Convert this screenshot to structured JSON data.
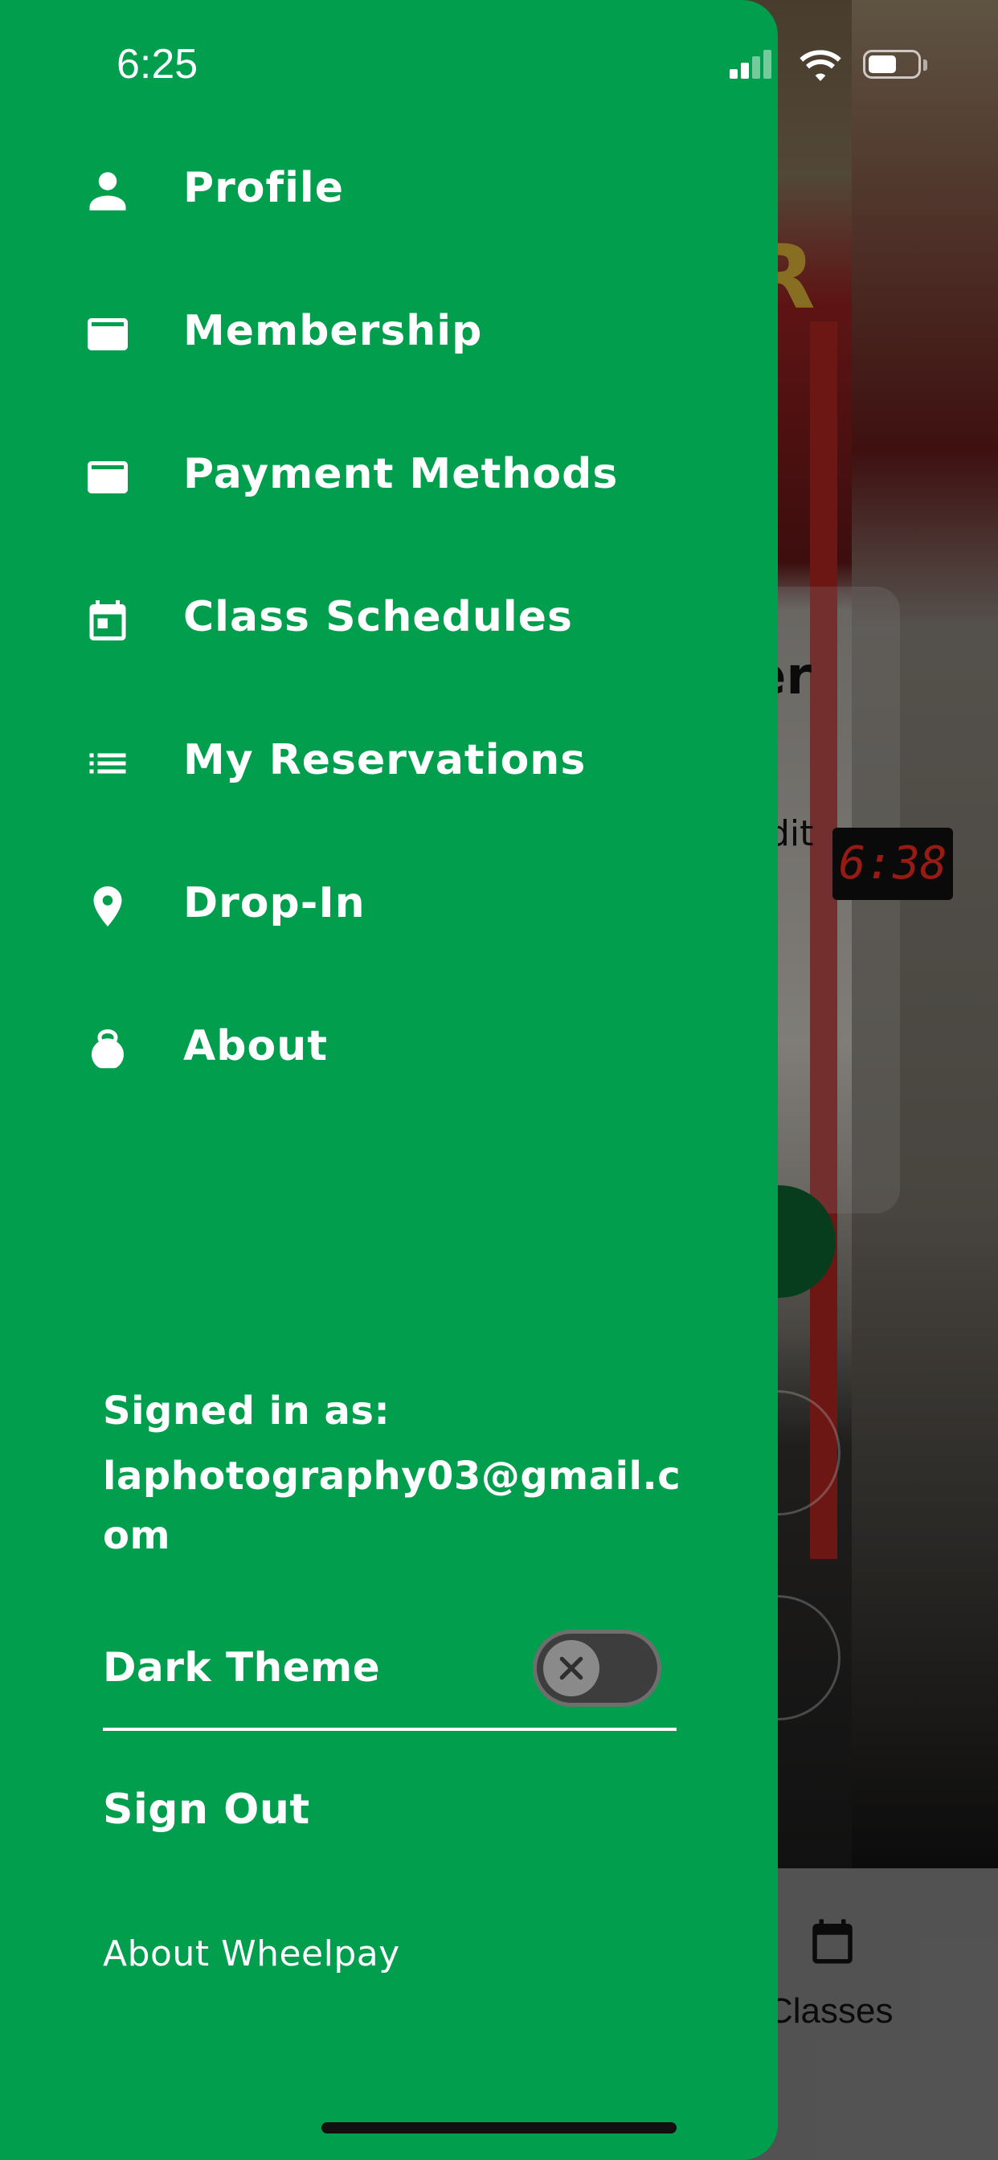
{
  "status_bar": {
    "time": "6:25",
    "signal_icon": "cellular-signal-icon",
    "wifi_icon": "wifi-icon",
    "battery_icon": "battery-icon"
  },
  "drawer": {
    "background_color": "#009e4d",
    "menu": [
      {
        "label": "Profile",
        "icon": "person-icon"
      },
      {
        "label": "Membership",
        "icon": "credit-card-icon"
      },
      {
        "label": "Payment Methods",
        "icon": "credit-card-icon"
      },
      {
        "label": "Class Schedules",
        "icon": "calendar-icon"
      },
      {
        "label": "My Reservations",
        "icon": "list-icon"
      },
      {
        "label": "Drop-In",
        "icon": "location-pin-icon"
      },
      {
        "label": "About",
        "icon": "kettlebell-icon"
      }
    ],
    "account": {
      "signed_in_label": "Signed in as:",
      "email": "laphotography03@gmail.com"
    },
    "dark_theme": {
      "label": "Dark Theme",
      "enabled": false
    },
    "sign_out_label": "Sign Out",
    "about_app_label": "About Wheelpay"
  },
  "background_app": {
    "heading_fragment": "er",
    "edit_fragment": "dit",
    "clock_display": "6:38",
    "tab_label": "Classes",
    "tab_icon": "calendar-icon"
  }
}
